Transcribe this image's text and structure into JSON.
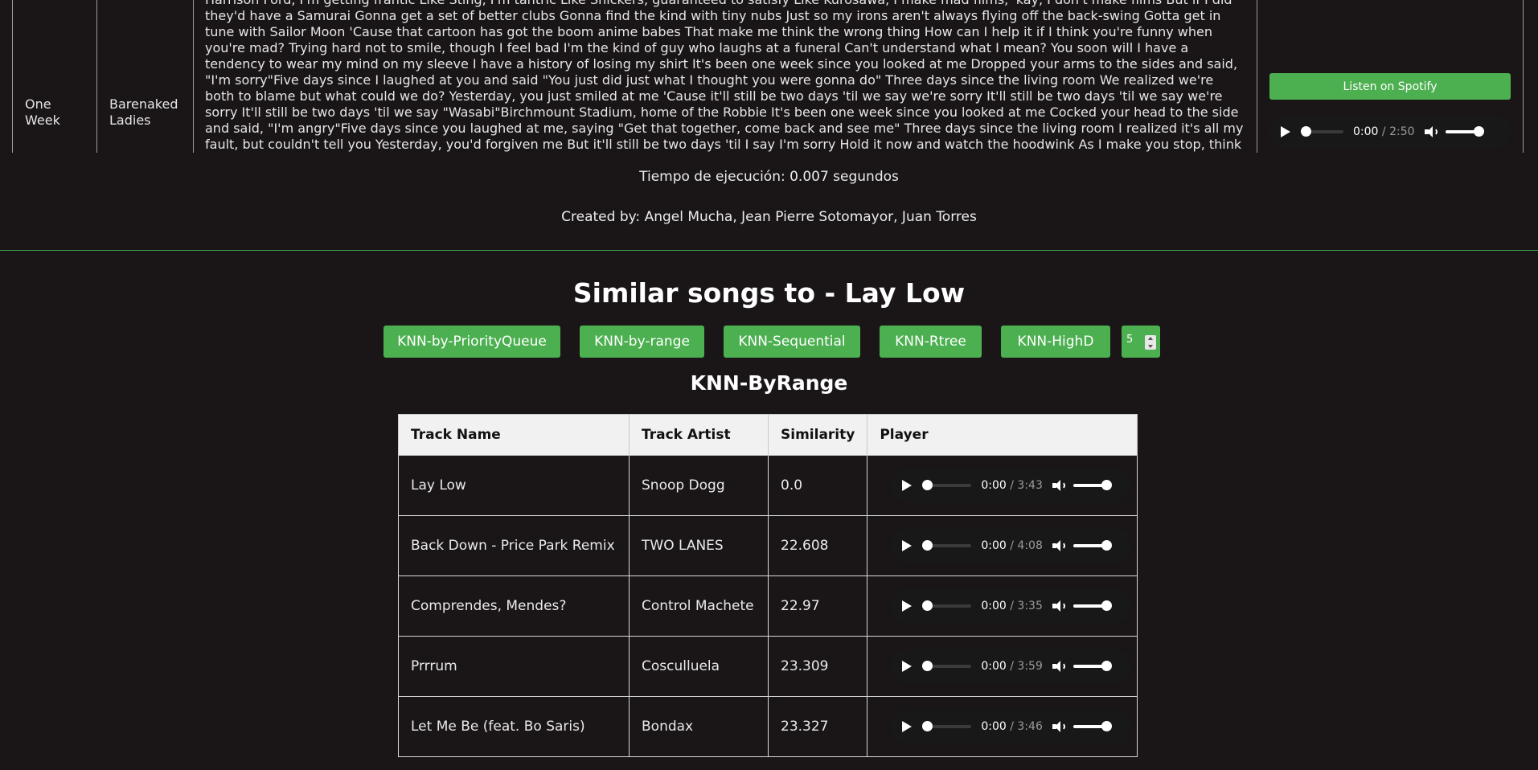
{
  "top_row": {
    "track": "One Week",
    "artist": "Barenaked Ladies",
    "lyrics": "Harrison Ford, I'm getting frantic Like Sting, I'm tantric Like Snickers, guaranteed to satisfy Like Kurosawa, I make mad films, 'kay, I don't make films But if I did they'd have a Samurai Gonna get a set of better clubs Gonna find the kind with tiny nubs Just so my irons aren't always flying off the back-swing Gotta get in tune with Sailor Moon 'Cause that cartoon has got the boom anime babes That make me think the wrong thing How can I help it if I think you're funny when you're mad? Trying hard not to smile, though I feel bad I'm the kind of guy who laughs at a funeral Can't understand what I mean? You soon will I have a tendency to wear my mind on my sleeve I have a history of losing my shirt It's been one week since you looked at me Dropped your arms to the sides and said, \"I'm sorry\"Five days since I laughed at you and said \"You just did just what I thought you were gonna do\" Three days since the living room We realized we're both to blame but what could we do? Yesterday, you just smiled at me 'Cause it'll still be two days 'til we say we're sorry It'll still be two days 'til we say we're sorry It'll still be two days 'til we say \"Wasabi\"Birchmount Stadium, home of the Robbie It's been one week since you looked at me Cocked your head to the side and said, \"I'm angry\"Five days since you laughed at me, saying \"Get that together, come back and see me\" Three days since the living room I realized it's all my fault, but couldn't tell you Yesterday, you'd forgiven me But it'll still be two days 'til I say I'm sorry Hold it now and watch the hoodwink As I make you stop, think You'll think you're looking at",
    "spotify_label": "Listen on Spotify",
    "player": {
      "current": "0:00",
      "total": "/ 2:50"
    }
  },
  "execution_time": "Tiempo de ejecución: 0.007 segundos",
  "credits": "Created by: Angel Mucha, Jean Pierre Sotomayor, Juan Torres",
  "similar": {
    "title": "Similar songs to - Lay Low",
    "buttons": [
      "KNN-by-PriorityQueue",
      "KNN-by-range",
      "KNN-Sequential",
      "KNN-Rtree",
      "KNN-HighD"
    ],
    "k_value": "5",
    "subtitle": "KNN-ByRange",
    "headers": [
      "Track Name",
      "Track Artist",
      "Similarity",
      "Player"
    ],
    "rows": [
      {
        "name": "Lay Low",
        "artist": "Snoop Dogg",
        "similarity": "0.0",
        "current": "0:00",
        "total": "/ 3:43"
      },
      {
        "name": "Back Down - Price Park Remix",
        "artist": "TWO LANES",
        "similarity": "22.608",
        "current": "0:00",
        "total": "/ 4:08"
      },
      {
        "name": "Comprendes, Mendes?",
        "artist": "Control Machete",
        "similarity": "22.97",
        "current": "0:00",
        "total": "/ 3:35"
      },
      {
        "name": "Prrrum",
        "artist": "Cosculluela",
        "similarity": "23.309",
        "current": "0:00",
        "total": "/ 3:59"
      },
      {
        "name": "Let Me Be (feat. Bo Saris)",
        "artist": "Bondax",
        "similarity": "23.327",
        "current": "0:00",
        "total": "/ 3:46"
      }
    ]
  },
  "colors": {
    "accent": "#4caf50",
    "background": "#1a1617",
    "divider": "#3d9a46"
  }
}
